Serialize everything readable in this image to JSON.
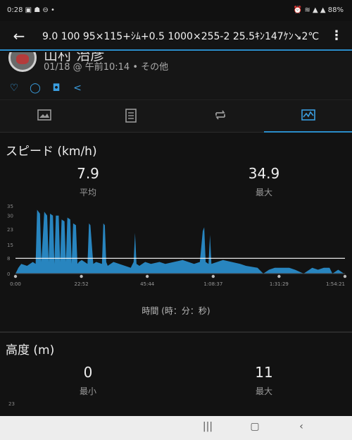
{
  "status_bar": {
    "time": "0:28",
    "left_icons": "▣ ☗ ⊖ •",
    "right_icons": "⏰ ≋ ▲ ▲ 88%"
  },
  "app_bar": {
    "title": "9.0 100 95×115+ｼﾑ+0.5 1000×255-2 25.5ｷﾝ147ｹﾝ↘2℃"
  },
  "activity": {
    "name": "山村 治彦",
    "meta": "01/18 @ 午前10:14 • その他"
  },
  "actions": {
    "like": "♡",
    "comment": "◯",
    "photo": "◘",
    "share": "<"
  },
  "tabs": [
    {
      "name": "summary"
    },
    {
      "name": "details"
    },
    {
      "name": "laps"
    },
    {
      "name": "charts"
    }
  ],
  "speed": {
    "title": "スピード (km/h)",
    "avg_value": "7.9",
    "avg_label": "平均",
    "max_value": "34.9",
    "max_label": "最大",
    "xaxis_label": "時間 (時：分：秒)"
  },
  "altitude": {
    "title": "高度 (m)",
    "min_value": "0",
    "min_label": "最小",
    "max_value": "11",
    "max_label": "最大",
    "y_tick_top": "23"
  },
  "chart_data": {
    "type": "area",
    "title": "",
    "xlabel": "時間 (時：分：秒)",
    "ylabel": "",
    "ylim": [
      0,
      35
    ],
    "avg_line": 7.9,
    "accent_color": "#2a8cc9",
    "y_ticks": [
      "35",
      "30",
      "23",
      "15",
      "8",
      "0"
    ],
    "y_tick_values": [
      35,
      30,
      23,
      15,
      8,
      0
    ],
    "x_ticks": [
      "0:00",
      "22:52",
      "45:44",
      "1:08:37",
      "1:31:29",
      "1:54:21"
    ],
    "x_tick_minutes": [
      0,
      22.87,
      45.73,
      68.62,
      91.48,
      114.35
    ],
    "series": [
      {
        "x": [
          0,
          1,
          2,
          4,
          6,
          7,
          7.5,
          8.5,
          9,
          10,
          11,
          11.5,
          12,
          13,
          13.5,
          14,
          15,
          15.5,
          16,
          17,
          17.5,
          18,
          19,
          19.5,
          20,
          21,
          21.5,
          22,
          23,
          24,
          25,
          25.5,
          26,
          27,
          28,
          30,
          30.5,
          31,
          31.5,
          32,
          33,
          34,
          36,
          38,
          40,
          41,
          41.5,
          42,
          43,
          45,
          47,
          50,
          52,
          55,
          58,
          60,
          62,
          64,
          65,
          65.5,
          66,
          67,
          67.5,
          68,
          70,
          72,
          75,
          78,
          80,
          84,
          86,
          88,
          90,
          92,
          95,
          97,
          100,
          103,
          105,
          107,
          109,
          110,
          112,
          114,
          114.35
        ],
        "y": [
          0,
          3,
          5,
          4,
          6,
          5,
          33,
          31,
          6,
          32,
          30,
          6,
          31,
          30,
          5,
          30,
          30,
          6,
          28,
          27,
          6,
          29,
          28,
          5,
          26,
          25,
          5,
          6,
          7,
          6,
          5,
          26,
          25,
          5,
          6,
          5,
          26,
          25,
          6,
          4,
          5,
          6,
          5,
          4,
          3,
          6,
          21,
          5,
          4,
          6,
          5,
          6,
          5,
          6,
          7,
          6,
          5,
          6,
          22,
          24,
          6,
          5,
          20,
          5,
          6,
          7,
          6,
          5,
          4,
          3,
          0,
          2,
          3,
          3,
          3,
          2,
          0,
          3,
          2,
          3,
          3,
          0,
          2,
          0,
          0
        ]
      }
    ]
  }
}
